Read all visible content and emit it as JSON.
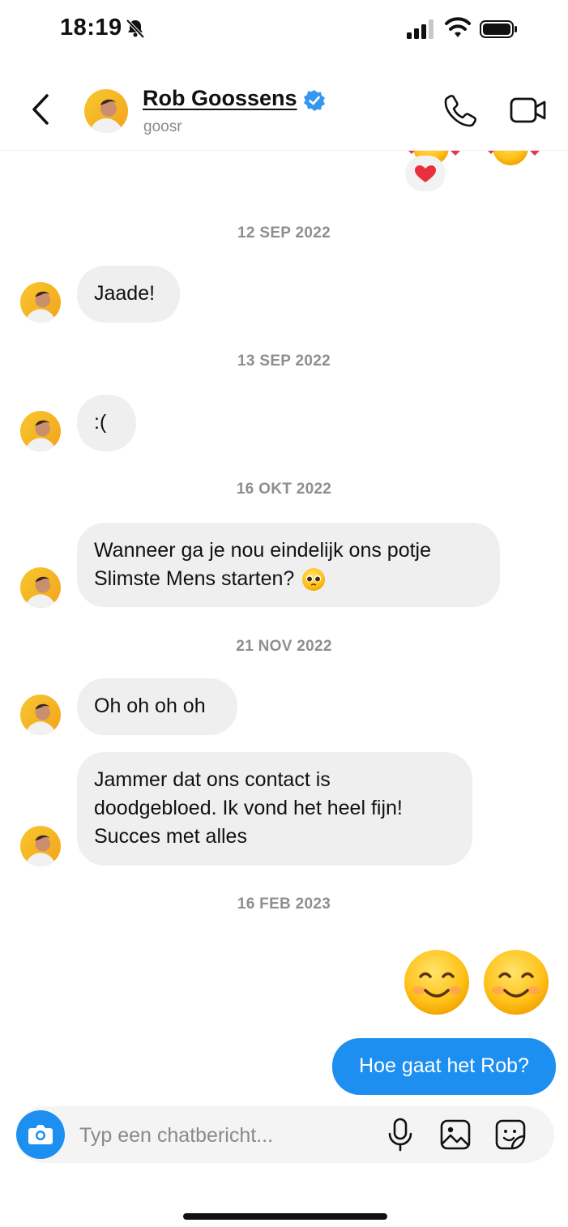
{
  "status_bar": {
    "time": "18:19"
  },
  "header": {
    "contact_name": "Rob Goossens",
    "username": "goosr"
  },
  "messages": {
    "date_1": "12 SEP 2022",
    "msg_1": "Jaade!",
    "date_2": "13 SEP 2022",
    "msg_2": ":(",
    "date_3": "16 OKT 2022",
    "msg_3_line1": "Wanneer ga je nou eindelijk ons potje",
    "msg_3_line2": "Slimste Mens starten?",
    "date_4": "21 NOV 2022",
    "msg_4": "Oh oh oh oh",
    "msg_5_line1": "Jammer dat ons contact is",
    "msg_5_line2": "doodgebloed. Ik vond het heel fijn!",
    "msg_5_line3": "Succes met alles",
    "date_5": "16 FEB 2023",
    "outgoing_emojis": [
      "smiling-face-emoji",
      "smiling-face-emoji"
    ],
    "outgoing_text": "Hoe gaat het Rob?"
  },
  "composer": {
    "placeholder": "Typ een chatbericht..."
  },
  "colors": {
    "accent": "#1d8ff0",
    "incoming_bubble": "#efefef",
    "verified": "#3797f0",
    "timestamp": "#8e8e8e"
  }
}
